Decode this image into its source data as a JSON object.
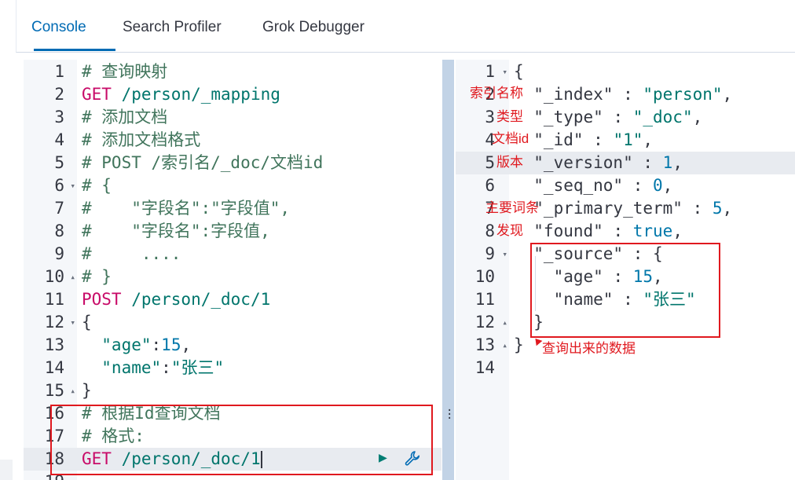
{
  "tabs": [
    {
      "label": "Console",
      "active": true
    },
    {
      "label": "Search Profiler",
      "active": false
    },
    {
      "label": "Grok Debugger",
      "active": false
    }
  ],
  "request_lines": [
    {
      "num": "1",
      "fold": "",
      "tokens": [
        {
          "t": "# 查询映射",
          "c": "comment"
        }
      ]
    },
    {
      "num": "2",
      "fold": "",
      "tokens": [
        {
          "t": "GET",
          "c": "method"
        },
        {
          "t": " /person/_mapping",
          "c": "url"
        }
      ]
    },
    {
      "num": "3",
      "fold": "",
      "tokens": [
        {
          "t": "# 添加文档",
          "c": "comment"
        }
      ]
    },
    {
      "num": "4",
      "fold": "",
      "tokens": [
        {
          "t": "# 添加文档格式",
          "c": "comment"
        }
      ]
    },
    {
      "num": "5",
      "fold": "",
      "tokens": [
        {
          "t": "# POST /索引名/_doc/文档id",
          "c": "comment"
        }
      ]
    },
    {
      "num": "6",
      "fold": "▾",
      "tokens": [
        {
          "t": "# {",
          "c": "comment"
        }
      ]
    },
    {
      "num": "7",
      "fold": "",
      "tokens": [
        {
          "t": "#    \"字段名\":\"字段值\",",
          "c": "comment"
        }
      ]
    },
    {
      "num": "8",
      "fold": "",
      "tokens": [
        {
          "t": "#    \"字段名\":字段值,",
          "c": "comment"
        }
      ]
    },
    {
      "num": "9",
      "fold": "",
      "tokens": [
        {
          "t": "#     ....",
          "c": "comment"
        }
      ]
    },
    {
      "num": "10",
      "fold": "▴",
      "tokens": [
        {
          "t": "# }",
          "c": "comment"
        }
      ]
    },
    {
      "num": "11",
      "fold": "",
      "tokens": [
        {
          "t": "POST",
          "c": "method"
        },
        {
          "t": " /person/_doc/1",
          "c": "url"
        }
      ]
    },
    {
      "num": "12",
      "fold": "▾",
      "tokens": [
        {
          "t": "{",
          "c": "punc"
        }
      ]
    },
    {
      "num": "13",
      "fold": "",
      "tokens": [
        {
          "t": "  \"age\"",
          "c": "str"
        },
        {
          "t": ":",
          "c": "punc"
        },
        {
          "t": "15",
          "c": "num"
        },
        {
          "t": ",",
          "c": "punc"
        }
      ]
    },
    {
      "num": "14",
      "fold": "",
      "tokens": [
        {
          "t": "  \"name\"",
          "c": "str"
        },
        {
          "t": ":",
          "c": "punc"
        },
        {
          "t": "\"张三\"",
          "c": "str"
        }
      ]
    },
    {
      "num": "15",
      "fold": "▴",
      "tokens": [
        {
          "t": "}",
          "c": "punc"
        }
      ]
    },
    {
      "num": "16",
      "fold": "",
      "tokens": [
        {
          "t": "# 根据Id查询文档",
          "c": "comment"
        }
      ]
    },
    {
      "num": "17",
      "fold": "",
      "tokens": [
        {
          "t": "# 格式:",
          "c": "comment"
        }
      ]
    },
    {
      "num": "18",
      "fold": "",
      "active": true,
      "tokens": [
        {
          "t": "GET",
          "c": "method"
        },
        {
          "t": " /person/_doc/1",
          "c": "url"
        }
      ]
    },
    {
      "num": "19",
      "fold": "",
      "tokens": []
    }
  ],
  "response_lines": [
    {
      "num": "1",
      "fold": "▾",
      "tokens": [
        {
          "t": "{",
          "c": "punc"
        }
      ]
    },
    {
      "num": "2",
      "fold": "",
      "tokens": [
        {
          "t": "  \"_index\"",
          "c": "key"
        },
        {
          "t": " : ",
          "c": "punc"
        },
        {
          "t": "\"person\"",
          "c": "str"
        },
        {
          "t": ",",
          "c": "punc"
        }
      ]
    },
    {
      "num": "3",
      "fold": "",
      "tokens": [
        {
          "t": "  \"_type\"",
          "c": "key"
        },
        {
          "t": " : ",
          "c": "punc"
        },
        {
          "t": "\"_doc\"",
          "c": "str"
        },
        {
          "t": ",",
          "c": "punc"
        }
      ]
    },
    {
      "num": "4",
      "fold": "",
      "tokens": [
        {
          "t": "  \"_id\"",
          "c": "key"
        },
        {
          "t": " : ",
          "c": "punc"
        },
        {
          "t": "\"1\"",
          "c": "str"
        },
        {
          "t": ",",
          "c": "punc"
        }
      ]
    },
    {
      "num": "5",
      "fold": "",
      "active": true,
      "tokens": [
        {
          "t": "  \"_version\"",
          "c": "key"
        },
        {
          "t": " : ",
          "c": "punc"
        },
        {
          "t": "1",
          "c": "num"
        },
        {
          "t": ",",
          "c": "punc"
        }
      ]
    },
    {
      "num": "6",
      "fold": "",
      "tokens": [
        {
          "t": "  \"_seq_no\"",
          "c": "key"
        },
        {
          "t": " : ",
          "c": "punc"
        },
        {
          "t": "0",
          "c": "num"
        },
        {
          "t": ",",
          "c": "punc"
        }
      ]
    },
    {
      "num": "7",
      "fold": "",
      "tokens": [
        {
          "t": "  \"_primary_term\"",
          "c": "key"
        },
        {
          "t": " : ",
          "c": "punc"
        },
        {
          "t": "5",
          "c": "num"
        },
        {
          "t": ",",
          "c": "punc"
        }
      ]
    },
    {
      "num": "8",
      "fold": "",
      "tokens": [
        {
          "t": "  \"found\"",
          "c": "key"
        },
        {
          "t": " : ",
          "c": "punc"
        },
        {
          "t": "true",
          "c": "bool"
        },
        {
          "t": ",",
          "c": "punc"
        }
      ]
    },
    {
      "num": "9",
      "fold": "▾",
      "tokens": [
        {
          "t": "  \"_source\"",
          "c": "key"
        },
        {
          "t": " : {",
          "c": "punc"
        }
      ]
    },
    {
      "num": "10",
      "fold": "",
      "tokens": [
        {
          "t": "    \"age\"",
          "c": "key"
        },
        {
          "t": " : ",
          "c": "punc"
        },
        {
          "t": "15",
          "c": "num"
        },
        {
          "t": ",",
          "c": "punc"
        }
      ]
    },
    {
      "num": "11",
      "fold": "",
      "tokens": [
        {
          "t": "    \"name\"",
          "c": "key"
        },
        {
          "t": " : ",
          "c": "punc"
        },
        {
          "t": "\"张三\"",
          "c": "str"
        }
      ]
    },
    {
      "num": "12",
      "fold": "▴",
      "tokens": [
        {
          "t": "  }",
          "c": "punc"
        }
      ]
    },
    {
      "num": "13",
      "fold": "▴",
      "tokens": [
        {
          "t": "}",
          "c": "punc"
        }
      ]
    },
    {
      "num": "14",
      "fold": "",
      "tokens": []
    }
  ],
  "annotations": {
    "index_name": "索引名称",
    "type": "类型",
    "doc_id": "文档id",
    "version": "版本",
    "primary_term": "主要词条",
    "found": "发现",
    "source_data": "查询出来的数据"
  },
  "icons": {
    "run": "play-icon",
    "settings": "wrench-icon",
    "grip": "vertical-dots-icon"
  },
  "colors": {
    "accent": "#006bb4",
    "annotation_red": "#e0191f"
  }
}
